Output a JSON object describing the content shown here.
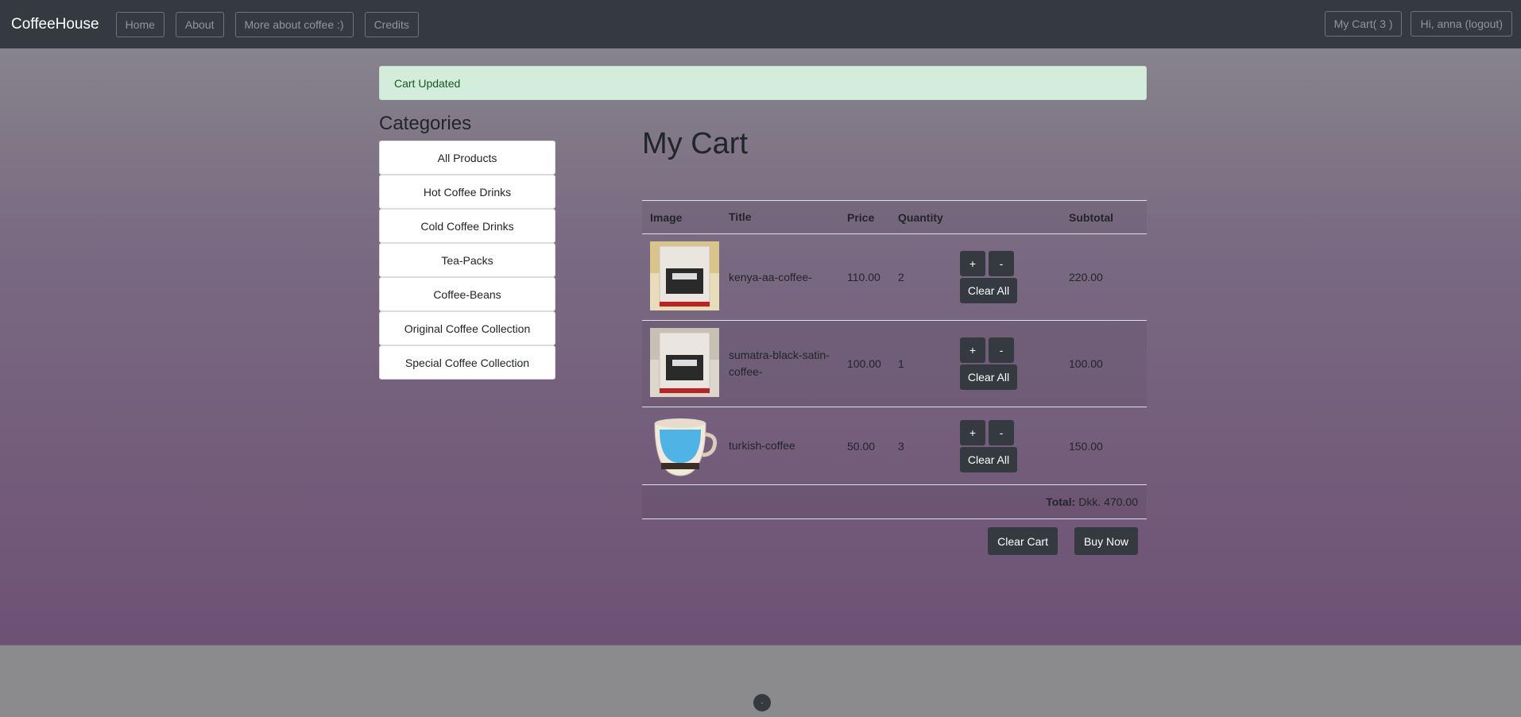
{
  "nav": {
    "brand": "CoffeeHouse",
    "links": [
      "Home",
      "About",
      "More about coffee :)",
      "Credits"
    ],
    "cart_label": "My Cart( 3 )",
    "user_label": "Hi, anna (logout)"
  },
  "alert": "Cart Updated",
  "categories": {
    "title": "Categories",
    "items": [
      "All Products",
      "Hot Coffee Drinks",
      "Cold Coffee Drinks",
      "Tea-Packs",
      "Coffee-Beans",
      "Original Coffee Collection",
      "Special Coffee Collection"
    ]
  },
  "cart": {
    "title": "My Cart",
    "headers": {
      "image": "Image",
      "title": "Title",
      "price": "Price",
      "quantity": "Quantity",
      "subtotal": "Subtotal"
    },
    "rows": [
      {
        "title": "kenya-aa-coffee-",
        "price": "110.00",
        "quantity": "2",
        "subtotal": "220.00",
        "image": "coffee-bag-kenya-icon"
      },
      {
        "title": "sumatra-black-satin-coffee-",
        "price": "100.00",
        "quantity": "1",
        "subtotal": "100.00",
        "image": "coffee-bag-sumatra-icon"
      },
      {
        "title": "turkish-coffee",
        "price": "50.00",
        "quantity": "3",
        "subtotal": "150.00",
        "image": "coffee-cup-icon"
      }
    ],
    "plus_label": "+",
    "minus_label": "-",
    "clear_all_label": "Clear All",
    "total_label": "Total:",
    "total_value": "Dkk. 470.00",
    "clear_cart_label": "Clear Cart",
    "buy_now_label": "Buy Now"
  },
  "footer": {
    "dot": "·"
  }
}
